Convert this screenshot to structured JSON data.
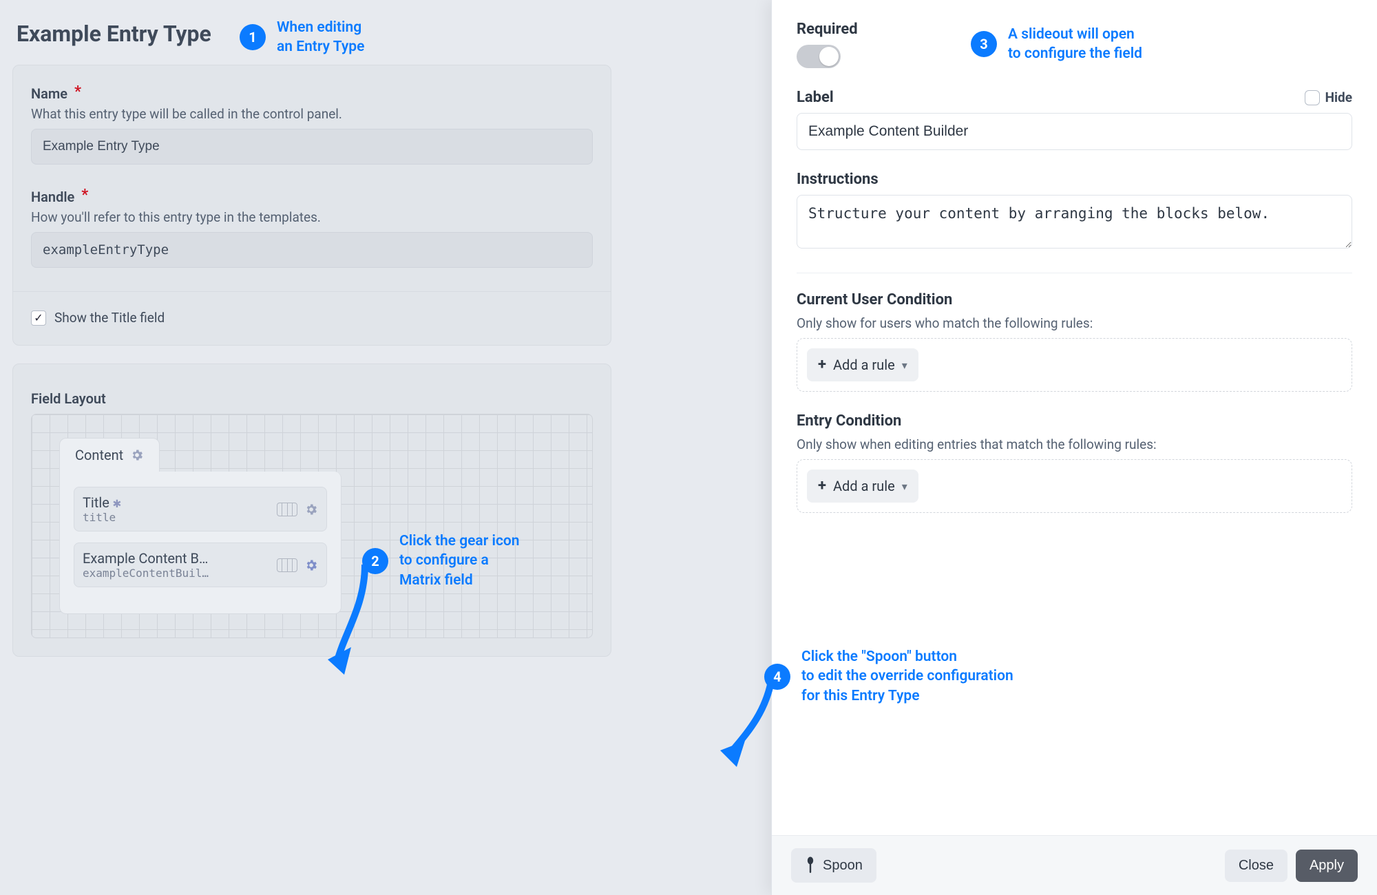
{
  "page_title": "Example Entry Type",
  "name_field": {
    "label": "Name",
    "hint": "What this entry type will be called in the control panel.",
    "value": "Example Entry Type"
  },
  "handle_field": {
    "label": "Handle",
    "hint": "How you'll refer to this entry type in the templates.",
    "value": "exampleEntryType"
  },
  "show_title": {
    "label": "Show the Title field",
    "checked": true
  },
  "field_layout": {
    "heading": "Field Layout",
    "tab_label": "Content",
    "fields": [
      {
        "name": "Title",
        "handle": "title",
        "required": true
      },
      {
        "name": "Example Content B…",
        "handle": "exampleContentBuil…",
        "required": false
      }
    ]
  },
  "slideout": {
    "required": {
      "label": "Required"
    },
    "label_field": {
      "label": "Label",
      "hide_label": "Hide",
      "value": "Example Content Builder"
    },
    "instructions": {
      "label": "Instructions",
      "value": "Structure your content by arranging the blocks below."
    },
    "user_condition": {
      "label": "Current User Condition",
      "hint": "Only show for users who match the following rules:",
      "add_rule": "Add a rule"
    },
    "entry_condition": {
      "label": "Entry Condition",
      "hint": "Only show when editing entries that match the following rules:",
      "add_rule": "Add a rule"
    },
    "footer": {
      "spoon": "Spoon",
      "close": "Close",
      "apply": "Apply"
    }
  },
  "callouts": {
    "c1": "When editing\nan Entry Type",
    "c2": "Click the gear icon\nto configure a\nMatrix field",
    "c3": "A slideout will open\nto configure the field",
    "c4": "Click the \"Spoon\" button\nto edit the override configuration\nfor this Entry Type"
  },
  "colors": {
    "accent": "#0b7bff"
  }
}
